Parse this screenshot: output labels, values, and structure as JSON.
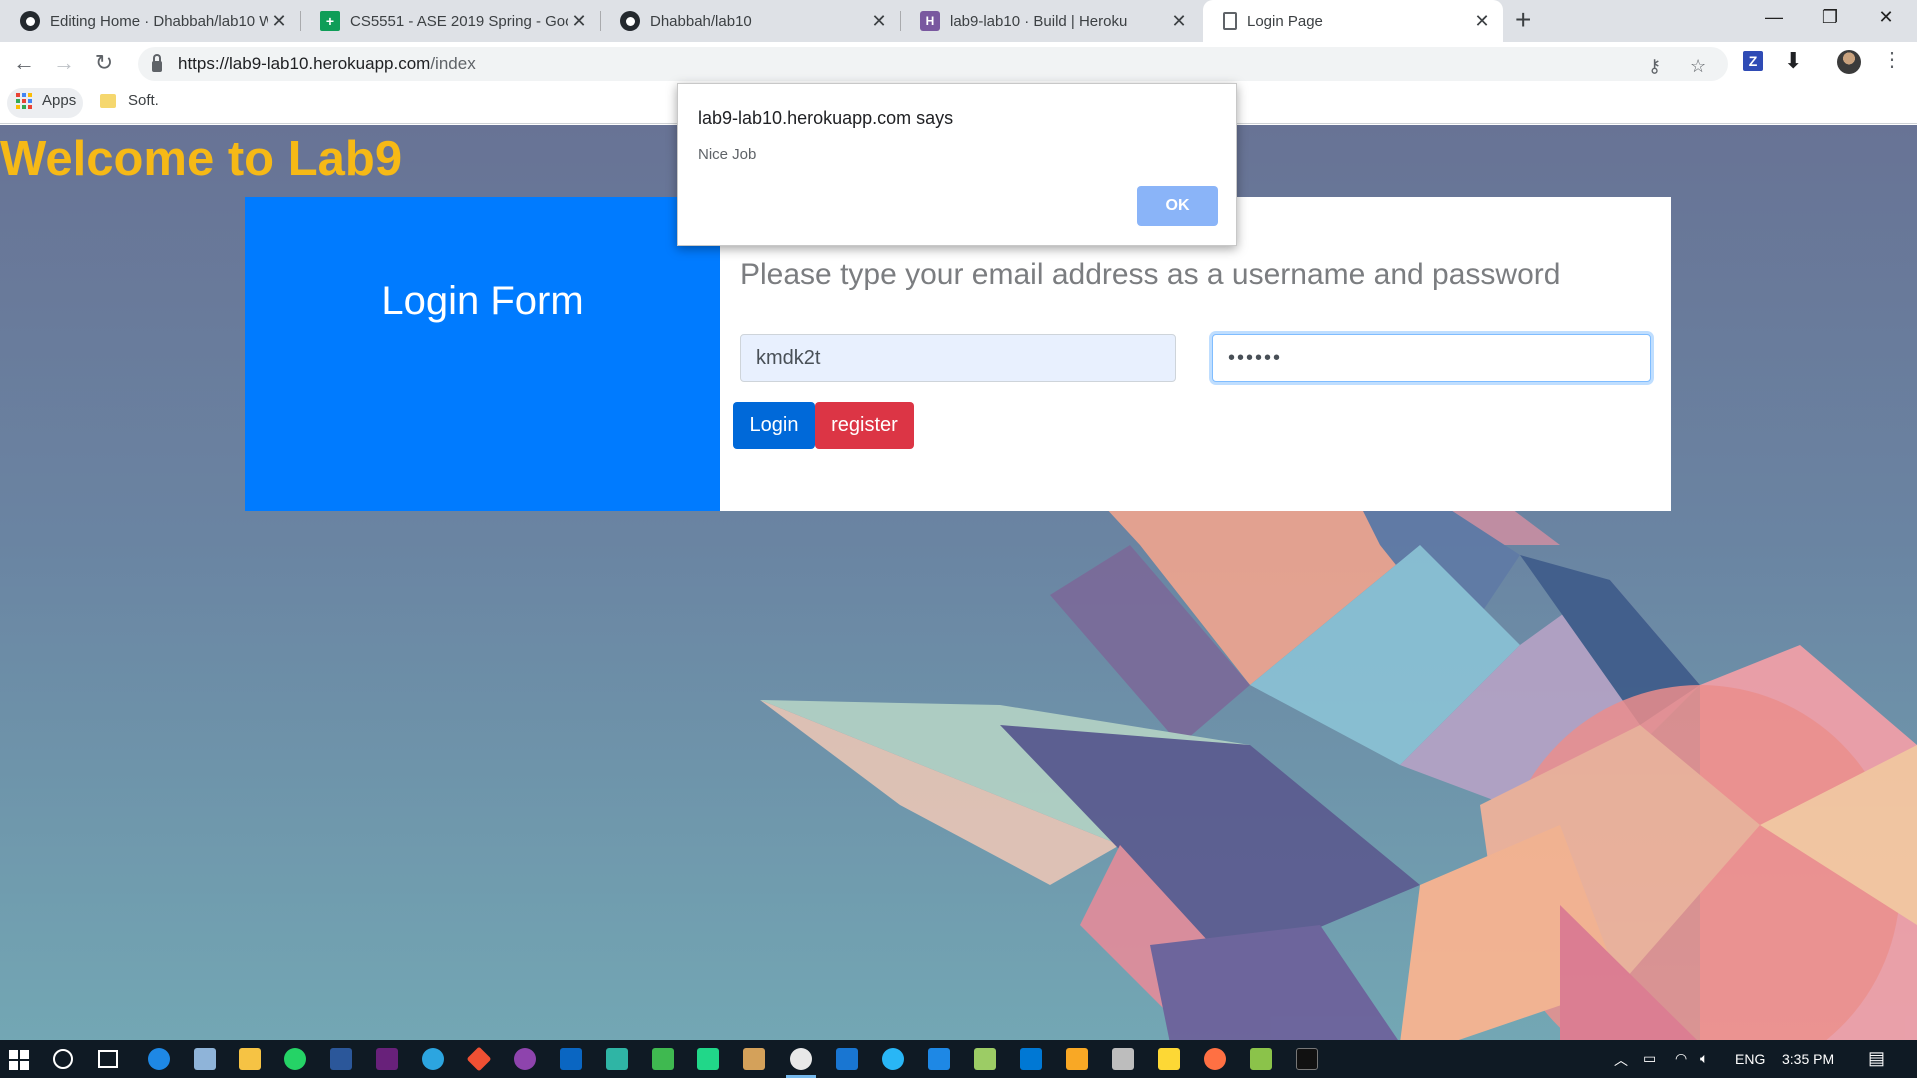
{
  "browser": {
    "tabs": [
      {
        "title": "Editing Home · Dhabbah/lab10 W",
        "favicon": "github-icon",
        "active": false
      },
      {
        "title": "CS5551 - ASE 2019 Spring - Goo",
        "favicon": "sheets-icon",
        "active": false
      },
      {
        "title": "Dhabbah/lab10",
        "favicon": "github-icon",
        "active": false
      },
      {
        "title": "lab9-lab10 · Build | Heroku",
        "favicon": "heroku-icon",
        "active": false
      },
      {
        "title": "Login Page",
        "favicon": "page-icon",
        "active": true
      }
    ],
    "new_tab": "+",
    "window_controls": {
      "minimize": "—",
      "restore": "❐",
      "close": "✕"
    },
    "url": {
      "host": "https://lab9-lab10.herokuapp.com",
      "path": "/index"
    },
    "bookmarks": [
      {
        "label": "Apps",
        "icon": "apps-grid-icon"
      },
      {
        "label": "Soft.",
        "icon": "folder-icon"
      }
    ],
    "extensions": {
      "z_label": "Z"
    }
  },
  "page": {
    "welcome": "Welcome to Lab9",
    "login_title": "Login Form",
    "prompt": "Please type your email address as a username and password",
    "username_value": "kmdk2t",
    "password_value": "••••••",
    "login_label": "Login",
    "register_label": "register"
  },
  "dialog": {
    "title": "lab9-lab10.herokuapp.com says",
    "message": "Nice Job",
    "ok_label": "OK"
  },
  "taskbar": {
    "language": "ENG",
    "time": "3:35 PM"
  },
  "colors": {
    "welcome": "#f6b916",
    "login_panel": "#007bff",
    "login_button": "#0069d9",
    "register_button": "#dc3545",
    "dialog_ok": "#8ab4f8"
  }
}
